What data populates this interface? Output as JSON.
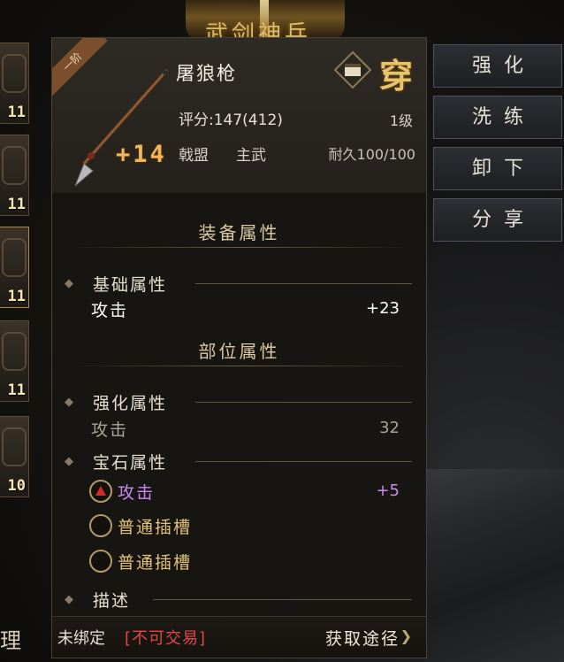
{
  "header": {
    "banner_text": "武剑神兵"
  },
  "slots": [
    {
      "level": "11"
    },
    {
      "level": "11"
    },
    {
      "level": "11"
    },
    {
      "level": "11"
    },
    {
      "level": "10"
    }
  ],
  "item": {
    "tier": "一阶",
    "name": "屠狼枪",
    "wear_label": "穿",
    "score": "评分:147(412)",
    "level": "1级",
    "enhance": "+14",
    "tag1": "戟盟",
    "tag2": "主武",
    "durability": "耐久100/100"
  },
  "sections": {
    "equip_attr": "装备属性",
    "part_attr": "部位属性"
  },
  "base": {
    "title": "基础属性",
    "label": "攻击",
    "value": "+23"
  },
  "strengthen": {
    "title": "强化属性",
    "label": "攻击",
    "value": "32"
  },
  "gems": {
    "title": "宝石属性",
    "items": [
      {
        "label": "攻击",
        "value": "+5"
      },
      {
        "label": "普通插槽",
        "value": ""
      },
      {
        "label": "普通插槽",
        "value": ""
      }
    ]
  },
  "description": {
    "title": "描述"
  },
  "footer": {
    "unbound": "未绑定",
    "no_trade": "[不可交易]",
    "source": "获取途径"
  },
  "actions": [
    {
      "label": "强化"
    },
    {
      "label": "洗练"
    },
    {
      "label": "卸下"
    },
    {
      "label": "分享"
    }
  ],
  "bottom_left": "理",
  "colors": {
    "gold": "#e7c36c",
    "purple_attr": "#c88cf0",
    "red_text": "#e04848",
    "enhance": "#f0b858"
  },
  "icons": [
    "tier-ribbon",
    "spear-icon",
    "wear-icon",
    "arrow-icon",
    "gem-icon",
    "chevron-right-icon"
  ]
}
